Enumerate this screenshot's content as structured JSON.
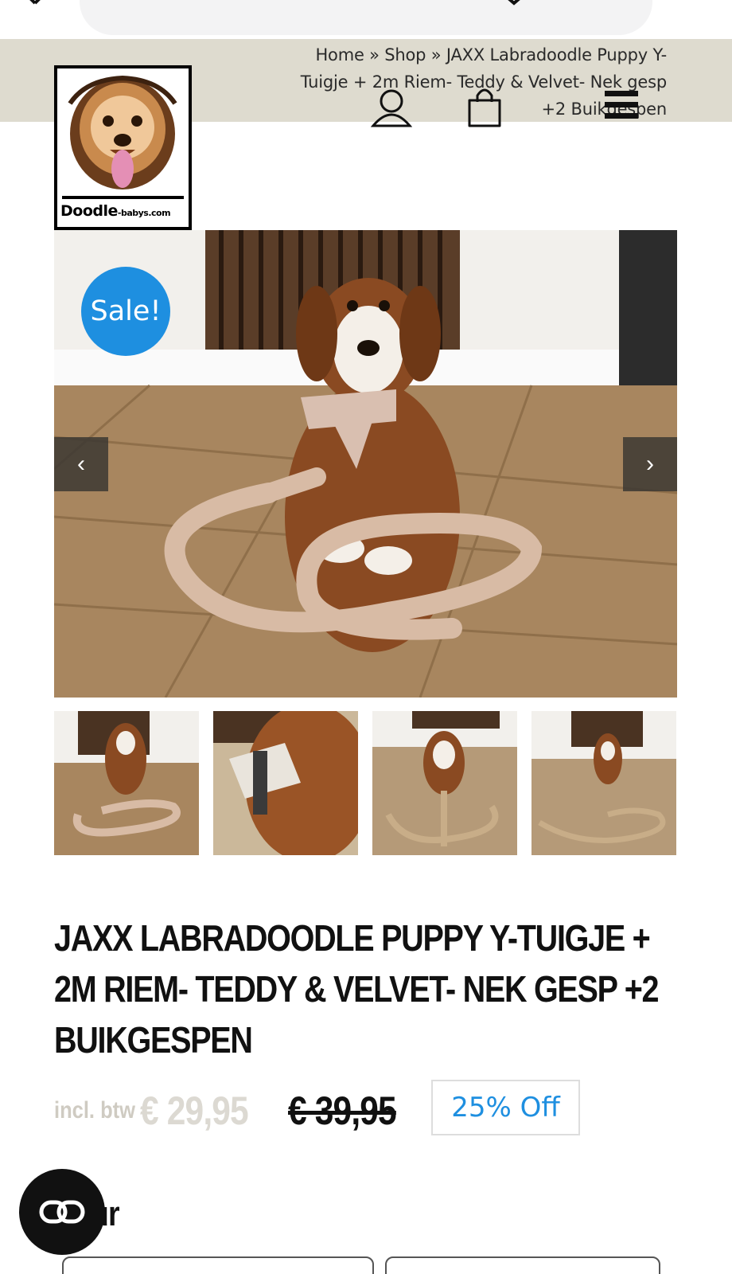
{
  "breadcrumb": {
    "text": "Home » Shop » JAXX Labradoodle Puppy Y-Tuigje + 2m Riem- Teddy & Velvet- Nek gesp +2 Buikgespen"
  },
  "logo": {
    "brand": "Doodle",
    "domain": "-babys.com"
  },
  "header_icons": [
    "account-icon",
    "cart-icon",
    "menu-icon"
  ],
  "gallery": {
    "badge": "Sale!",
    "prev": "‹",
    "next": "›",
    "thumbnails": 4
  },
  "product": {
    "title": "JAXX LABRADOODLE PUPPY Y-TUIGJE + 2M RIEM- TEDDY & VELVET- NEK GESP +2 BUIKGESPEN",
    "price_prefix": "incl. btw",
    "price_current": "€ 29,95",
    "price_old": "€ 39,95",
    "discount": "25% Off",
    "option_label": "ur"
  },
  "colors": {
    "header_band": "#dedbcf",
    "sale_badge": "#1e8fe0",
    "discount_text": "#1e8fe0"
  }
}
